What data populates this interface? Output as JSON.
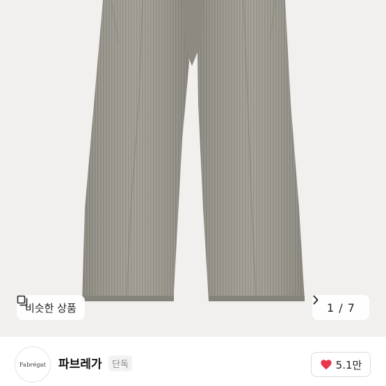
{
  "gallery": {
    "similar_label": "비슷한 상품",
    "page_current": "1",
    "page_sep": "/",
    "page_total": "7",
    "next_icon": "chevron-right-icon"
  },
  "store": {
    "logo_text": "Fabrégat",
    "name": "파브레가",
    "badge": "단독",
    "likes": "5.1만",
    "heart_color": "#e8364c"
  }
}
